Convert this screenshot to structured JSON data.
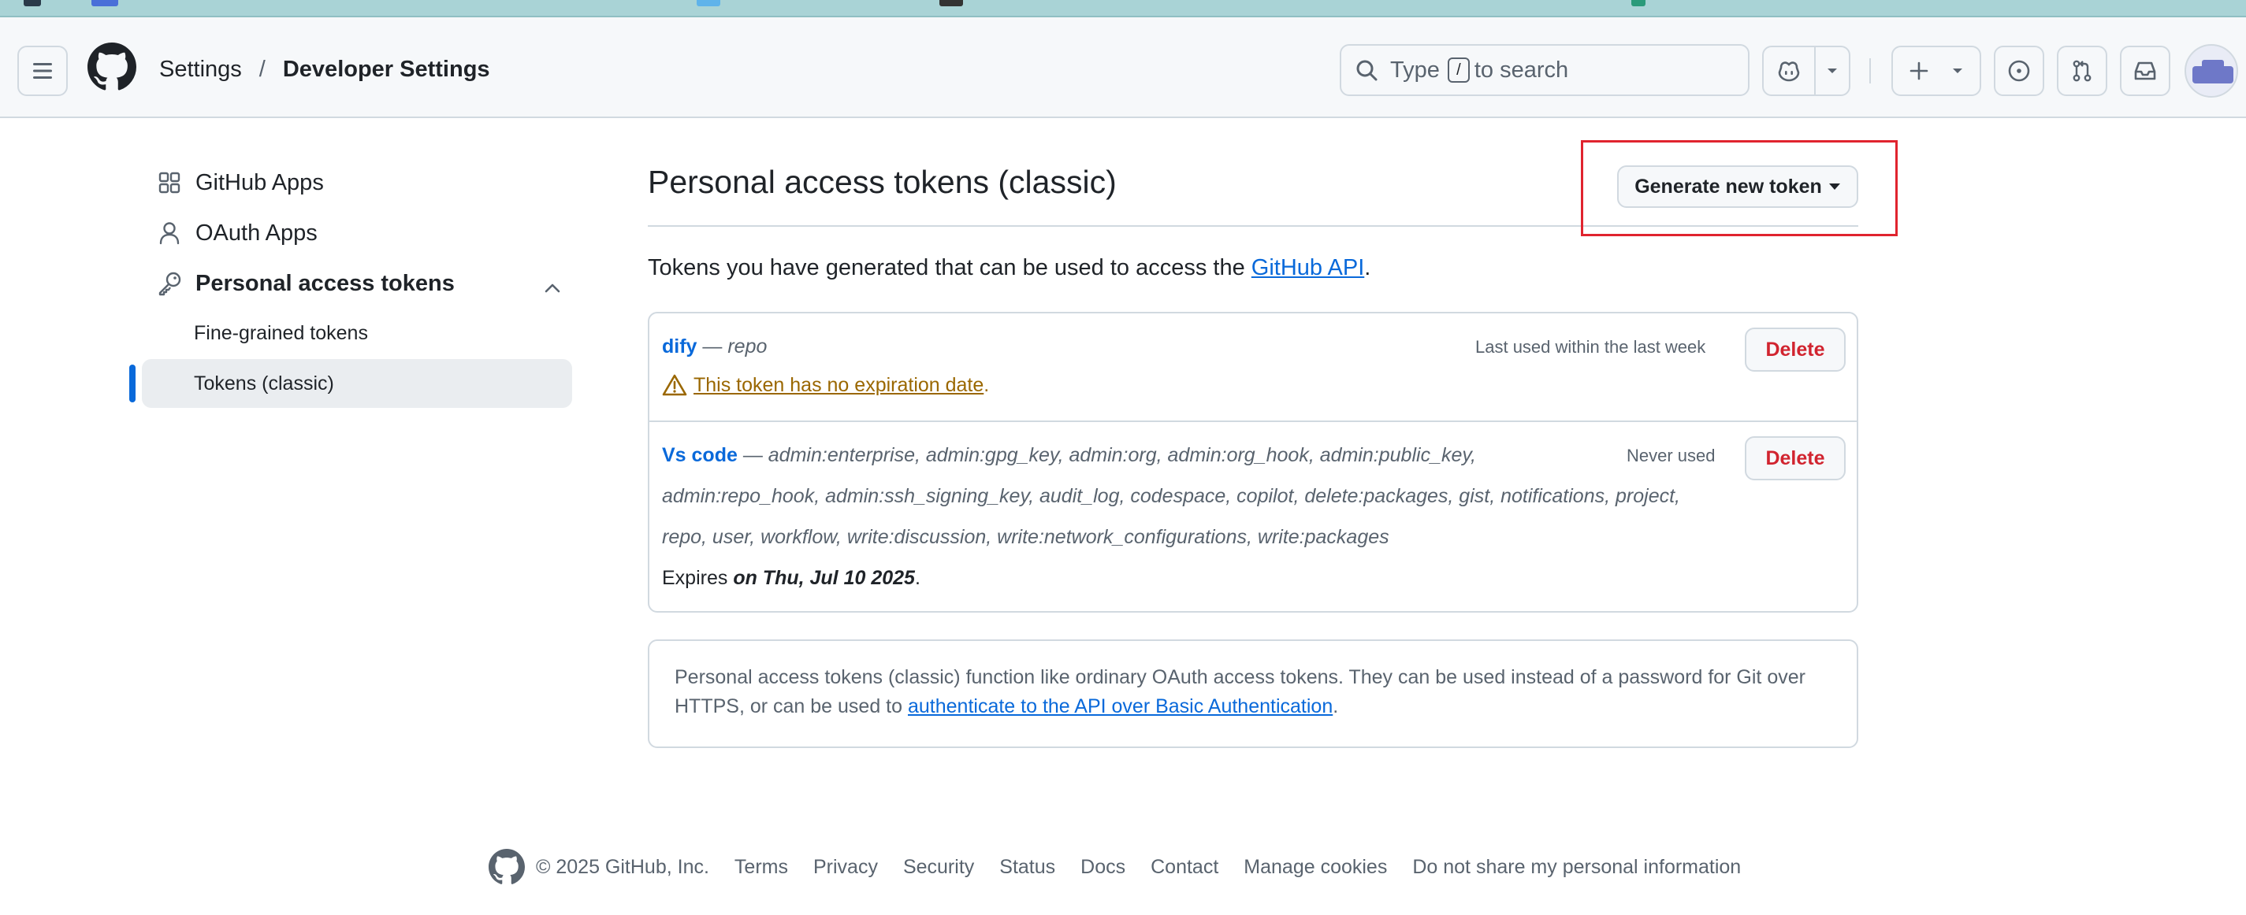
{
  "header": {
    "breadcrumb": {
      "settings": "Settings",
      "separator": "/",
      "current": "Developer Settings"
    },
    "search": {
      "prefix": "Type",
      "key": "/",
      "suffix": "to search"
    },
    "icons": [
      "hamburger-icon",
      "github-logo-icon",
      "search-icon",
      "copilot-icon",
      "chevron-down-icon",
      "plus-icon",
      "issue-icon",
      "pull-request-icon",
      "inbox-icon"
    ]
  },
  "sidebar": {
    "items": [
      {
        "label": "GitHub Apps",
        "icon": "apps-grid-icon"
      },
      {
        "label": "OAuth Apps",
        "icon": "person-icon"
      },
      {
        "label": "Personal access tokens",
        "icon": "key-icon"
      }
    ],
    "sub_items": [
      {
        "label": "Fine-grained tokens"
      },
      {
        "label": "Tokens (classic)",
        "active": true
      }
    ]
  },
  "main": {
    "title": "Personal access tokens (classic)",
    "generate_button": "Generate new token",
    "intro_prefix": "Tokens you have generated that can be used to access the ",
    "intro_link": "GitHub API",
    "intro_suffix": ".",
    "tokens": [
      {
        "name": "dify",
        "dash": " — ",
        "scopes": "repo",
        "last_used": "Last used within the last week",
        "delete": "Delete",
        "warning": "This token has no expiration date",
        "warning_suffix": "."
      },
      {
        "name": "Vs code",
        "dash": " — ",
        "scopes_line1": "admin:enterprise, admin:gpg_key, admin:org, admin:org_hook, admin:public_key,",
        "scopes_line2": "admin:repo_hook, admin:ssh_signing_key, audit_log, codespace, copilot, delete:packages, gist, notifications, project,",
        "scopes_line3": "repo, user, workflow, write:discussion, write:network_configurations, write:packages",
        "last_used": "Never used",
        "delete": "Delete",
        "expires_prefix": "Expires ",
        "expires_date": "on Thu, Jul 10 2025",
        "expires_suffix": "."
      }
    ],
    "info_text": "Personal access tokens (classic) function like ordinary OAuth access tokens. They can be used instead of a password for Git over HTTPS, or can be used to ",
    "info_link": "authenticate to the API over Basic Authentication",
    "info_suffix": "."
  },
  "footer": {
    "copyright": "© 2025 GitHub, Inc.",
    "links": [
      "Terms",
      "Privacy",
      "Security",
      "Status",
      "Docs",
      "Contact",
      "Manage cookies",
      "Do not share my personal information"
    ]
  },
  "colors": {
    "accent": "#0969da",
    "danger": "#d1242f",
    "warning": "#9a6700",
    "highlight_box": "#e0242e"
  }
}
